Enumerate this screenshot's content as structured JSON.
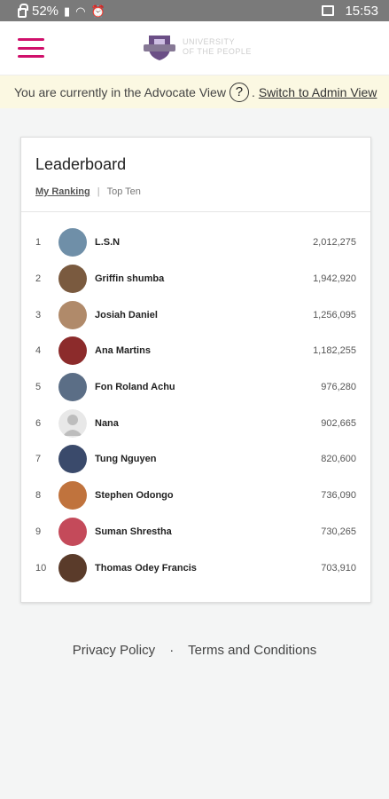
{
  "status_bar": {
    "battery": "52%",
    "time": "15:53"
  },
  "header": {
    "logo_line1": "UNIVERSITY",
    "logo_line2": "OF THE PEOPLE"
  },
  "banner": {
    "text": "You are currently in the Advocate View",
    "help": "?",
    "separator": ".",
    "switch_label": "Switch to Admin View"
  },
  "card": {
    "title": "Leaderboard",
    "tabs": {
      "my_ranking": "My Ranking",
      "separator": "|",
      "top_ten": "Top Ten"
    },
    "rows": [
      {
        "rank": "1",
        "name": "L.S.N",
        "score": "2,012,275",
        "avatar_color": "#6f8fa8"
      },
      {
        "rank": "2",
        "name": "Griffin shumba",
        "score": "1,942,920",
        "avatar_color": "#7a5a3f"
      },
      {
        "rank": "3",
        "name": "Josiah Daniel",
        "score": "1,256,095",
        "avatar_color": "#b08a6a"
      },
      {
        "rank": "4",
        "name": "Ana Martins",
        "score": "1,182,255",
        "avatar_color": "#8c2b2b"
      },
      {
        "rank": "5",
        "name": "Fon Roland Achu",
        "score": "976,280",
        "avatar_color": "#5b6e86"
      },
      {
        "rank": "6",
        "name": "Nana",
        "score": "902,665",
        "avatar_color": "#d4d4d4"
      },
      {
        "rank": "7",
        "name": "Tung Nguyen",
        "score": "820,600",
        "avatar_color": "#3a4a6b"
      },
      {
        "rank": "8",
        "name": "Stephen Odongo",
        "score": "736,090",
        "avatar_color": "#c0733d"
      },
      {
        "rank": "9",
        "name": "Suman Shrestha",
        "score": "730,265",
        "avatar_color": "#c44a5a"
      },
      {
        "rank": "10",
        "name": "Thomas Odey Francis",
        "score": "703,910",
        "avatar_color": "#5a3b2a"
      }
    ]
  },
  "footer": {
    "privacy": "Privacy Policy",
    "separator": "·",
    "terms": "Terms and Conditions"
  },
  "colors": {
    "accent": "#d0106b",
    "banner_bg": "#fbf8e2"
  }
}
